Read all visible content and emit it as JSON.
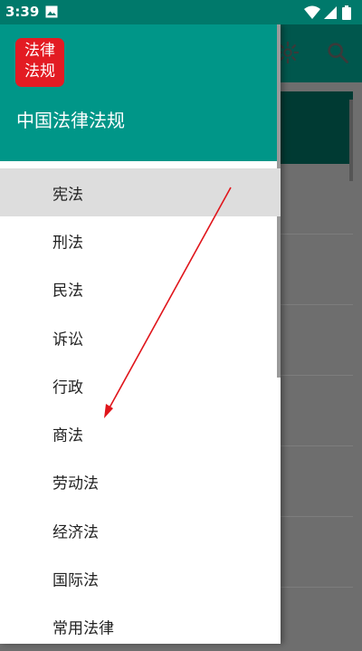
{
  "status_bar": {
    "time": "3:39"
  },
  "drawer": {
    "logo_line1": "法律",
    "logo_line2": "法规",
    "title": "中国法律法规",
    "items": [
      {
        "label": "宪法",
        "active": true
      },
      {
        "label": "刑法"
      },
      {
        "label": "民法"
      },
      {
        "label": "诉讼"
      },
      {
        "label": "行政"
      },
      {
        "label": "商法"
      },
      {
        "label": "劳动法"
      },
      {
        "label": "经济法"
      },
      {
        "label": "国际法"
      },
      {
        "label": "常用法律"
      }
    ]
  },
  "icons": {
    "gear": "gear-icon",
    "search": "search-icon",
    "image": "image-icon",
    "wifi": "wifi-icon",
    "signal": "signal-icon",
    "battery": "battery-icon"
  },
  "colors": {
    "accent": "#009688",
    "status_bar": "#00796b",
    "logo_red": "#e31b23",
    "annotation_arrow": "#e0151b"
  }
}
